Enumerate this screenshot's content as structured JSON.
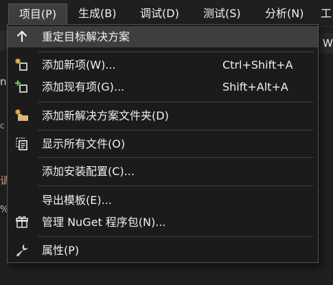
{
  "menubar": {
    "items": [
      {
        "label": "项目(P)"
      },
      {
        "label": "生成(B)"
      },
      {
        "label": "调试(D)"
      },
      {
        "label": "测试(S)"
      },
      {
        "label": "分析(N)"
      },
      {
        "label": "工"
      }
    ]
  },
  "background": {
    "fragments": [
      "c",
      "n",
      "请",
      "%",
      "W"
    ]
  },
  "dropdown": {
    "items": [
      {
        "label": "重定目标解决方案",
        "shortcut": "",
        "icon": "arrow-up-icon"
      },
      {
        "label": "添加新项(W)...",
        "shortcut": "Ctrl+Shift+A",
        "icon": "add-new-item-icon"
      },
      {
        "label": "添加现有项(G)...",
        "shortcut": "Shift+Alt+A",
        "icon": "add-existing-item-icon"
      },
      {
        "label": "添加新解决方案文件夹(D)",
        "shortcut": "",
        "icon": "new-folder-icon"
      },
      {
        "label": "显示所有文件(O)",
        "shortcut": "",
        "icon": "show-all-files-icon"
      },
      {
        "label": "添加安装配置(C)...",
        "shortcut": "",
        "icon": ""
      },
      {
        "label": "导出模板(E)...",
        "shortcut": "",
        "icon": ""
      },
      {
        "label": "管理 NuGet 程序包(N)...",
        "shortcut": "",
        "icon": "nuget-package-icon"
      },
      {
        "label": "属性(P)",
        "shortcut": "",
        "icon": "wrench-icon"
      }
    ]
  },
  "colors": {
    "background": "#1f1f1f",
    "menu_background": "#1b1b1c",
    "highlight": "#3e3e40",
    "text": "#f1f1f1",
    "accent_star": "#e8b44a",
    "accent_plus": "#6fbe5e",
    "folder": "#dcb67a"
  }
}
